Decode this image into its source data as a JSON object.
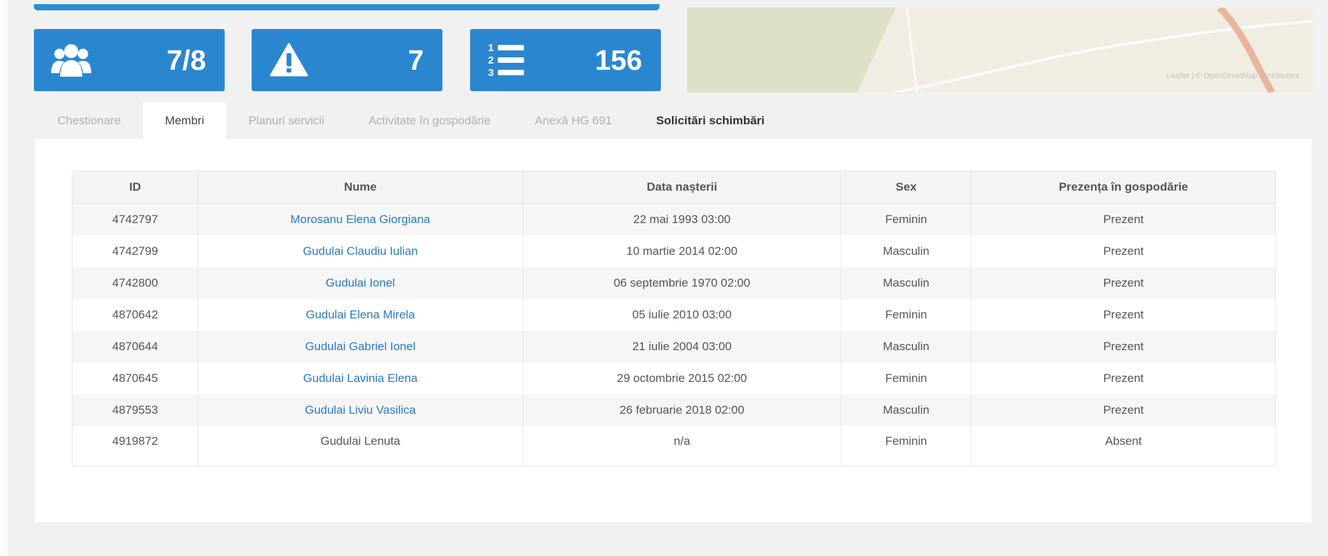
{
  "stats": {
    "members": {
      "icon": "users-icon",
      "value": "7/8"
    },
    "alerts": {
      "icon": "warning-icon",
      "value": "7"
    },
    "list": {
      "icon": "numbered-list-icon",
      "value": "156"
    }
  },
  "map": {
    "attribution": "Leaflet | © OpenStreetMap contributors"
  },
  "tabs": [
    "Chestionare",
    "Membri",
    "Planuri servicii",
    "Activitate în gospodărie",
    "Anexă HG 691",
    "Solicitări schimbări"
  ],
  "active_tab": "Membri",
  "table": {
    "columns": [
      "ID",
      "Nume",
      "Data nașterii",
      "Sex",
      "Prezența în gospodărie"
    ],
    "rows": [
      {
        "id": "4742797",
        "name": "Morosanu Elena Giorgiana",
        "dob": "22 mai 1993 03:00",
        "sex": "Feminin",
        "presence": "Prezent",
        "link": true
      },
      {
        "id": "4742799",
        "name": "Gudulai Claudiu Iulian",
        "dob": "10 martie 2014 02:00",
        "sex": "Masculin",
        "presence": "Prezent",
        "link": true
      },
      {
        "id": "4742800",
        "name": "Gudulai Ionel",
        "dob": "06 septembrie 1970 02:00",
        "sex": "Masculin",
        "presence": "Prezent",
        "link": true
      },
      {
        "id": "4870642",
        "name": "Gudulai Elena Mirela",
        "dob": "05 iulie 2010 03:00",
        "sex": "Feminin",
        "presence": "Prezent",
        "link": true
      },
      {
        "id": "4870644",
        "name": "Gudulai Gabriel Ionel",
        "dob": "21 iulie 2004 03:00",
        "sex": "Masculin",
        "presence": "Prezent",
        "link": true
      },
      {
        "id": "4870645",
        "name": "Gudulai Lavinia Elena",
        "dob": "29 octombrie 2015 02:00",
        "sex": "Feminin",
        "presence": "Prezent",
        "link": true
      },
      {
        "id": "4879553",
        "name": "Gudulai Liviu Vasilica",
        "dob": "26 februarie 2018 02:00",
        "sex": "Masculin",
        "presence": "Prezent",
        "link": true
      },
      {
        "id": "4919872",
        "name": "Gudulai Lenuta",
        "dob": "n/a",
        "sex": "Feminin",
        "presence": "Absent",
        "link": false
      }
    ]
  },
  "colors": {
    "accent": "#2a87cf",
    "link": "#2a7bc0"
  }
}
